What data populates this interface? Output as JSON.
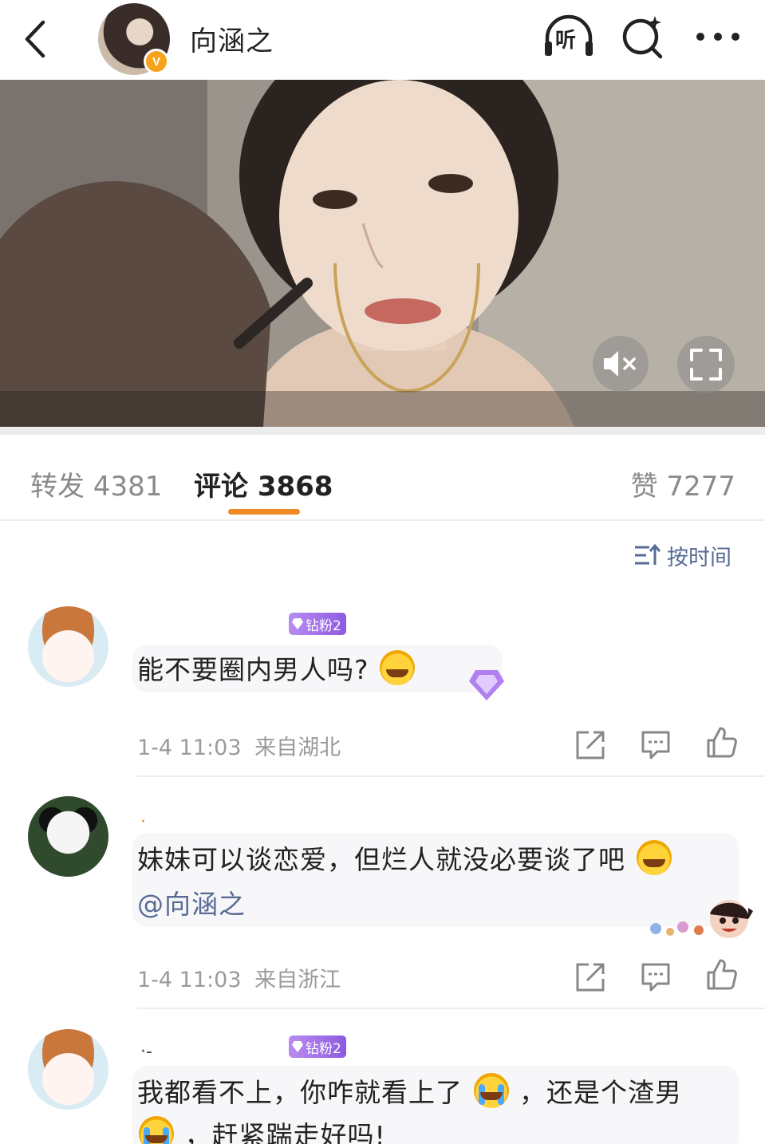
{
  "header": {
    "title": "向涵之",
    "verified_badge": "V",
    "listen_label": "听"
  },
  "tabs": {
    "repost": "转发 4381",
    "comments": "评论 3868",
    "likes": "赞 7277"
  },
  "sort": {
    "label": "按时间"
  },
  "comments": [
    {
      "fan_badge": "钻粉2",
      "name_mark": "",
      "text": "能不要圈内男人吗?",
      "time": "1-4 11:03",
      "location": "来自湖北"
    },
    {
      "fan_badge": "",
      "name_mark": "·",
      "text": "妹妹可以谈恋爱，但烂人就没必要谈了吧",
      "mention": "@向涵之",
      "time": "1-4 11:03",
      "location": "来自浙江"
    },
    {
      "fan_badge": "钻粉2",
      "name_mark": "·-",
      "text_a": "我都看不上，你咋就看上了",
      "text_b": "，还是个渣男",
      "text_c": "，赶紧踹走好吗!"
    }
  ],
  "colors": {
    "accent": "#f08a24",
    "link": "#576b95",
    "fan_badge": "#9b6be6",
    "verified": "#f7a21b"
  },
  "icons": {
    "back": "chevron-left-icon",
    "listen": "headphones-icon",
    "search": "search-sparkle-icon",
    "more": "more-dots-icon",
    "mute": "speaker-muted-icon",
    "fullscreen": "fullscreen-icon",
    "sort": "sort-icon",
    "share": "share-icon",
    "comment": "comment-icon",
    "like": "thumbs-up-icon"
  }
}
